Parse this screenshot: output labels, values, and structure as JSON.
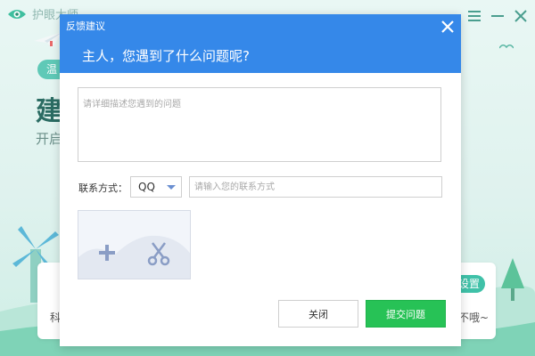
{
  "background": {
    "app_title": "护眼大师",
    "tag": "温",
    "big_text": "建",
    "subtitle": "开启",
    "card_left": "科",
    "card_right": "不哦~",
    "card_button": "设置"
  },
  "dialog": {
    "title": "反馈建议",
    "heading": "主人，您遇到了什么问题呢?",
    "description_placeholder": "请详细描述您遇到的问题",
    "contact_label": "联系方式：",
    "contact_type": "QQ",
    "contact_placeholder": "请输入您的联系方式",
    "close_label": "关闭",
    "submit_label": "提交问题"
  },
  "colors": {
    "header_blue": "#3588e9",
    "submit_green": "#27c256"
  },
  "icons": [
    "eye-icon",
    "menu-icon",
    "minimize-icon",
    "close-icon",
    "plus-icon",
    "scissors-icon",
    "chevron-down-icon"
  ]
}
